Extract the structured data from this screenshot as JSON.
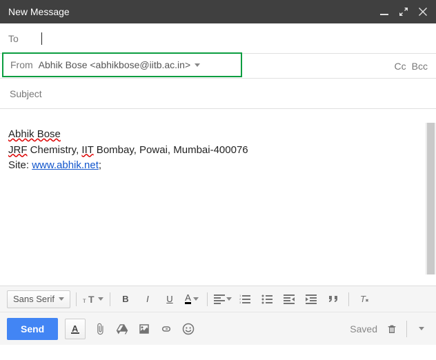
{
  "header": {
    "title": "New Message"
  },
  "to": {
    "label": "To",
    "value": ""
  },
  "from": {
    "label": "From",
    "value": "Abhik Bose <abhikbose@iitb.ac.in>"
  },
  "cc_label": "Cc",
  "bcc_label": "Bcc",
  "subject": {
    "placeholder": "Subject",
    "value": ""
  },
  "signature": {
    "name": "Abhik Bose",
    "line2_pre": "JRF",
    "line2_mid1": " Chemistry",
    "line2_comma1": ", ",
    "line2_iit": "IIT",
    "line2_rest": " Bombay, Powai, Mumbai-400076",
    "site_label": "Site: ",
    "site_url": "www.abhik.net",
    "site_tail": ";"
  },
  "toolbar": {
    "font_family": "Sans Serif",
    "size": "T",
    "bold": "B",
    "italic": "I",
    "underline": "U",
    "textcolor": "A"
  },
  "bottom": {
    "send": "Send",
    "saved": "Saved"
  }
}
